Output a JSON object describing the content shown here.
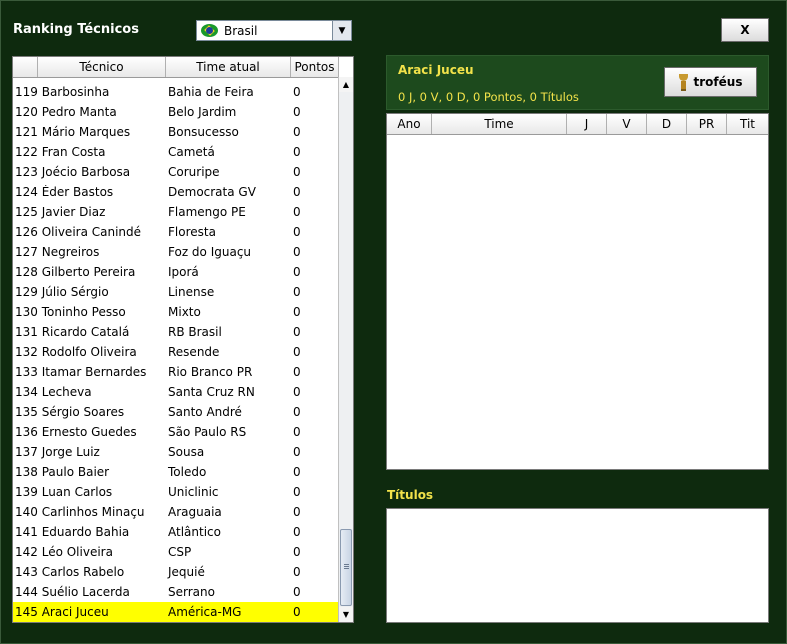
{
  "header": {
    "title": "Ranking Técnicos",
    "country_selected": "Brasil",
    "close_label": "X"
  },
  "ranking_table": {
    "columns": [
      "Técnico",
      "Time atual",
      "Pontos"
    ],
    "rows": [
      {
        "name": "119 Barbosinha",
        "team": "Bahia de Feira",
        "points": "0"
      },
      {
        "name": "120 Pedro Manta",
        "team": "Belo Jardim",
        "points": "0"
      },
      {
        "name": "121 Mário Marques",
        "team": "Bonsucesso",
        "points": "0"
      },
      {
        "name": "122 Fran Costa",
        "team": "Cametá",
        "points": "0"
      },
      {
        "name": "123 Joécio Barbosa",
        "team": "Coruripe",
        "points": "0"
      },
      {
        "name": "124 Éder Bastos",
        "team": "Democrata GV",
        "points": "0"
      },
      {
        "name": "125 Javier Diaz",
        "team": "Flamengo PE",
        "points": "0"
      },
      {
        "name": "126 Oliveira Canindé",
        "team": "Floresta",
        "points": "0"
      },
      {
        "name": "127 Negreiros",
        "team": "Foz do Iguaçu",
        "points": "0"
      },
      {
        "name": "128 Gilberto Pereira",
        "team": "Iporá",
        "points": "0"
      },
      {
        "name": "129 Júlio Sérgio",
        "team": "Linense",
        "points": "0"
      },
      {
        "name": "130 Toninho Pesso",
        "team": "Mixto",
        "points": "0"
      },
      {
        "name": "131 Ricardo Catalá",
        "team": "RB Brasil",
        "points": "0"
      },
      {
        "name": "132 Rodolfo Oliveira",
        "team": "Resende",
        "points": "0"
      },
      {
        "name": "133 Itamar Bernardes",
        "team": "Rio Branco PR",
        "points": "0"
      },
      {
        "name": "134 Lecheva",
        "team": "Santa Cruz RN",
        "points": "0"
      },
      {
        "name": "135 Sérgio Soares",
        "team": "Santo André",
        "points": "0"
      },
      {
        "name": "136 Ernesto Guedes",
        "team": "São Paulo RS",
        "points": "0"
      },
      {
        "name": "137 Jorge Luiz",
        "team": "Sousa",
        "points": "0"
      },
      {
        "name": "138 Paulo Baier",
        "team": "Toledo",
        "points": "0"
      },
      {
        "name": "139 Luan Carlos",
        "team": "Uniclinic",
        "points": "0"
      },
      {
        "name": "140 Carlinhos Minaçu",
        "team": "Araguaia",
        "points": "0"
      },
      {
        "name": "141 Eduardo Bahia",
        "team": "Atlântico",
        "points": "0"
      },
      {
        "name": "142 Léo Oliveira",
        "team": "CSP",
        "points": "0"
      },
      {
        "name": "143 Carlos Rabelo",
        "team": "Jequié",
        "points": "0"
      },
      {
        "name": "144 Suélio Lacerda",
        "team": "Serrano",
        "points": "0"
      },
      {
        "name": "145 Araci Juceu",
        "team": "América-MG",
        "points": "0",
        "selected": true
      }
    ]
  },
  "coach_detail": {
    "name": "Araci Juceu",
    "stats": "0 J, 0 V, 0 D, 0 Pontos, 0 Títulos",
    "trophies_label": "troféus",
    "history_columns": [
      "Ano",
      "Time",
      "J",
      "V",
      "D",
      "PR",
      "Tit"
    ],
    "titles_label": "Títulos"
  },
  "colors": {
    "background": "#0e2a0e",
    "panel": "#1d4a1d",
    "highlight_text": "#f2e24a",
    "selected_row": "#ffff00"
  }
}
